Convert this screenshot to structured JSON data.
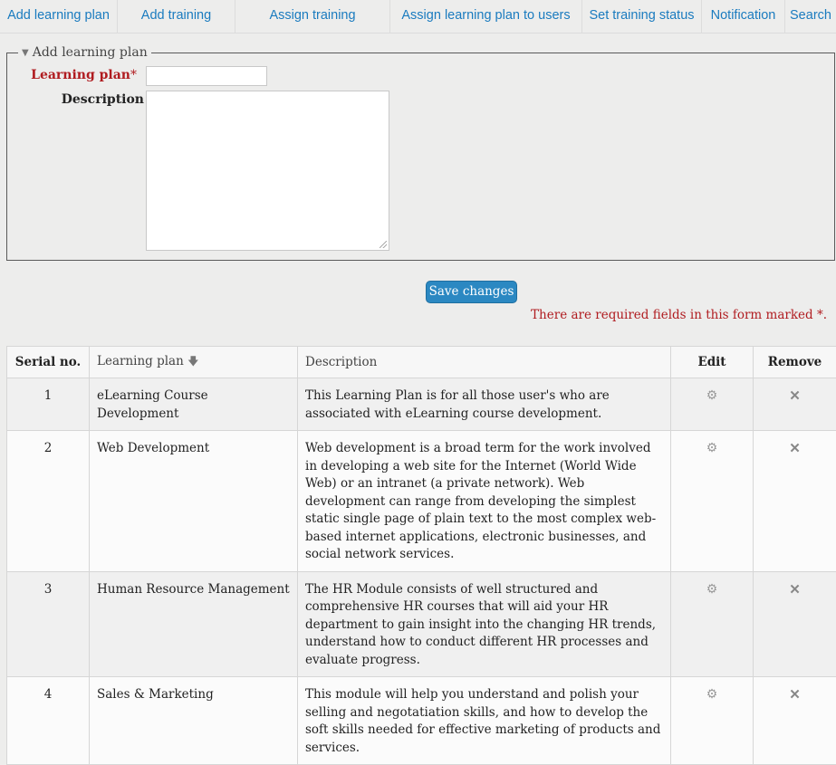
{
  "nav": {
    "items": [
      {
        "label": "Add learning plan"
      },
      {
        "label": "Add training"
      },
      {
        "label": "Assign training"
      },
      {
        "label": "Assign learning plan to users"
      },
      {
        "label": "Set training status"
      },
      {
        "label": "Notification"
      },
      {
        "label": "Search"
      }
    ]
  },
  "form": {
    "legend": "Add learning plan",
    "learning_plan_label": "Learning plan",
    "required_mark": "*",
    "description_label": "Description",
    "learning_plan_value": "",
    "description_value": ""
  },
  "actions": {
    "save_label": "Save changes",
    "required_note": "There are required fields in this form marked",
    "required_star": "*",
    "required_end": "."
  },
  "table": {
    "headers": {
      "serial": "Serial no.",
      "plan": "Learning plan",
      "description": "Description",
      "edit": "Edit",
      "remove": "Remove"
    },
    "sort_icon": "arrow-down-icon",
    "rows": [
      {
        "serial": "1",
        "plan": "eLearning Course Development",
        "description": "This Learning Plan is for all those user's who are associated with eLearning course development."
      },
      {
        "serial": "2",
        "plan": "Web Development",
        "description": "Web development is a broad term for the work involved in developing a web site for the Internet (World Wide Web) or an intranet (a private network). Web development can range from developing the simplest static single page of plain text to the most complex web-based internet applications, electronic businesses, and social network services."
      },
      {
        "serial": "3",
        "plan": "Human Resource Management",
        "description": "The HR Module consists of well structured and comprehensive HR courses that will aid your HR department to gain insight into the changing HR trends, understand how to conduct different HR processes and evaluate progress."
      },
      {
        "serial": "4",
        "plan": "Sales & Marketing",
        "description": "This module will help you understand and polish your selling and negotatiation skills, and how to develop the soft skills needed for effective marketing of products and services."
      }
    ]
  },
  "colors": {
    "link": "#1a7bbf",
    "required": "#b01c20",
    "button": "#2b88c2",
    "background": "#ededec"
  }
}
